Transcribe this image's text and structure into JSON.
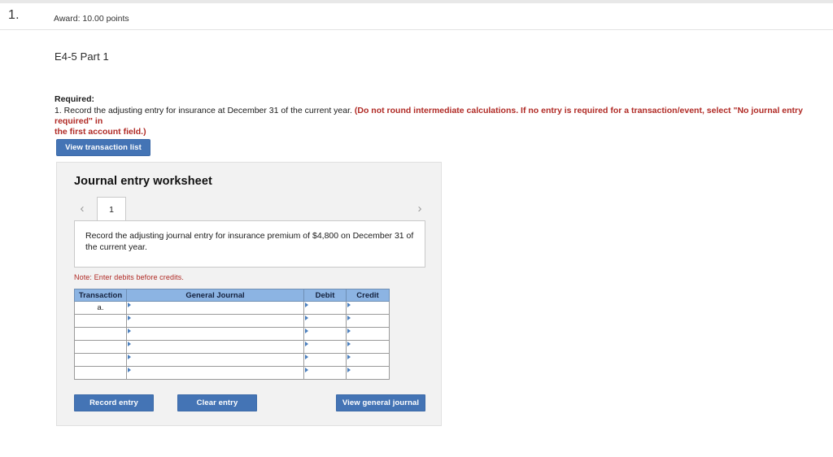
{
  "question": {
    "number": "1.",
    "award": "Award: 10.00 points"
  },
  "page_title": "E4-5 Part 1",
  "required": {
    "label": "Required:",
    "line1_plain": "1. Record the adjusting entry for insurance at December 31 of the current year. ",
    "line1_red": "(Do not round intermediate calculations. If no entry is required for a transaction/event, select \"No journal entry required\" in",
    "line2_red": "the first account field.)"
  },
  "toolbar": {
    "view_transaction_list": "View transaction list"
  },
  "worksheet": {
    "title": "Journal entry worksheet",
    "pager": {
      "prev_icon": "chevron-left-icon",
      "next_icon": "chevron-right-icon",
      "tabs": [
        "1"
      ],
      "active_tab": "1"
    },
    "prompt": "Record the adjusting journal entry for insurance premium of $4,800 on December 31 of the current year.",
    "note": "Note: Enter debits before credits.",
    "table": {
      "columns": [
        "Transaction",
        "General Journal",
        "Debit",
        "Credit"
      ],
      "rows": [
        {
          "transaction": "a.",
          "general_journal": "",
          "debit": "",
          "credit": ""
        },
        {
          "transaction": "",
          "general_journal": "",
          "debit": "",
          "credit": ""
        },
        {
          "transaction": "",
          "general_journal": "",
          "debit": "",
          "credit": ""
        },
        {
          "transaction": "",
          "general_journal": "",
          "debit": "",
          "credit": ""
        },
        {
          "transaction": "",
          "general_journal": "",
          "debit": "",
          "credit": ""
        },
        {
          "transaction": "",
          "general_journal": "",
          "debit": "",
          "credit": ""
        }
      ]
    },
    "buttons": {
      "record_entry": "Record entry",
      "clear_entry": "Clear entry",
      "view_general_journal": "View general journal"
    }
  },
  "colors": {
    "button_blue": "#4474b5",
    "table_header_blue": "#8cb4e3",
    "alert_red": "#b02a25",
    "panel_gray": "#f2f2f2",
    "input_border_blue": "#4a7ebc"
  }
}
